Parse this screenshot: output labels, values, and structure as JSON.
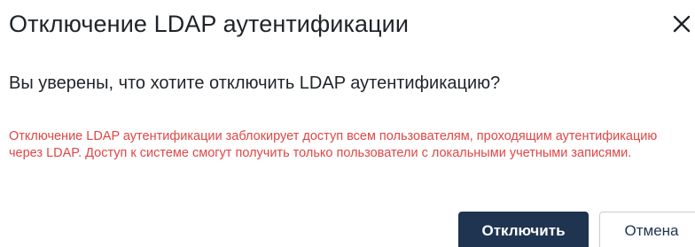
{
  "dialog": {
    "title": "Отключение LDAP аутентификации",
    "question": "Вы уверены, что хотите отключить LDAP аутентификацию?",
    "warning": "Отключение LDAP аутентификации заблокирует доступ всем пользователям, проходящим аутентификацию через LDAP. Доступ к системе смогут получить только пользователи с локальными учетными записями.",
    "close_icon": "close-icon",
    "buttons": {
      "confirm_label": "Отключить",
      "cancel_label": "Отмена"
    }
  },
  "colors": {
    "text": "#1f2429",
    "warning": "#e04646",
    "primary": "#1e3450",
    "secondary_border": "#c5ccd4"
  }
}
